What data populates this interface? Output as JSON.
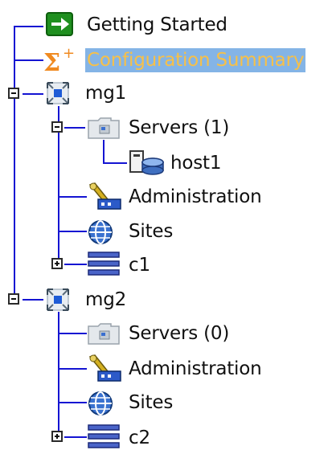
{
  "tree": {
    "getting_started": "Getting Started",
    "config_summary": "Configuration Summary",
    "mg1": {
      "label": "mg1",
      "servers": "Servers (1)",
      "host": "host1",
      "administration": "Administration",
      "sites": "Sites",
      "cluster": "c1"
    },
    "mg2": {
      "label": "mg2",
      "servers": "Servers (0)",
      "administration": "Administration",
      "sites": "Sites",
      "cluster": "c2"
    }
  },
  "colors": {
    "tree_line": "#1414d2",
    "selection_bg": "#84b4e6",
    "selection_text": "#f7c048",
    "arrow_green": "#1f8f1f",
    "sigma_orange": "#f08a20"
  }
}
